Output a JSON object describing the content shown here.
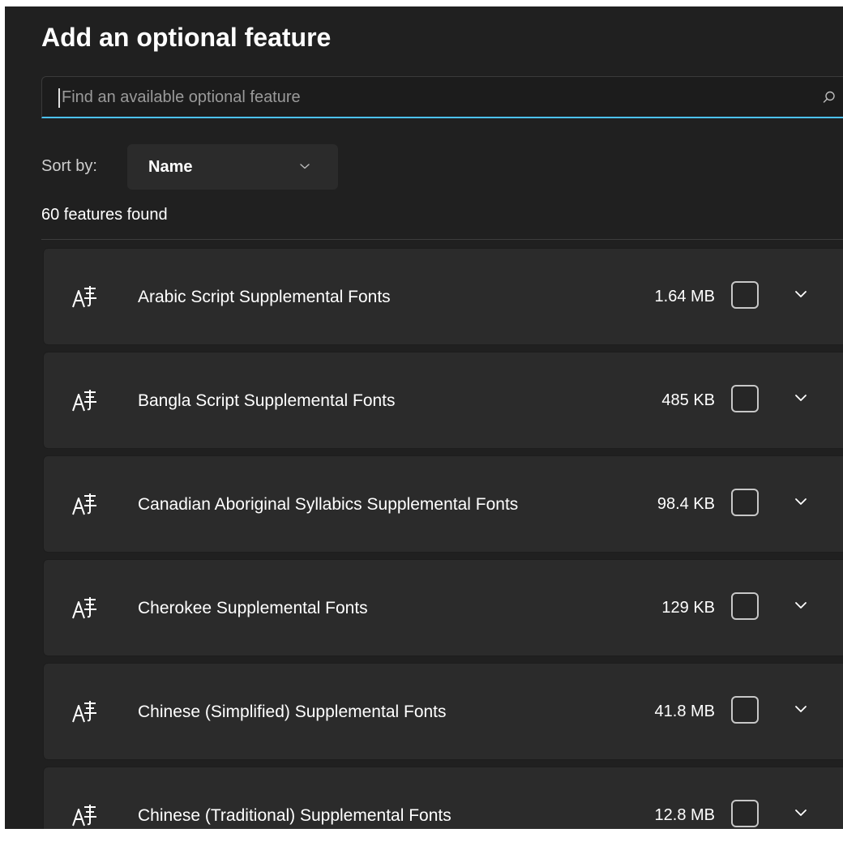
{
  "title": "Add an optional feature",
  "search": {
    "placeholder": "Find an available optional feature",
    "icon": "search-icon"
  },
  "sort": {
    "label": "Sort by:",
    "value": "Name"
  },
  "count_text": "60 features found",
  "colors": {
    "background": "#202020",
    "card": "#2b2b2b",
    "accent": "#4cc2ff",
    "text": "#ffffff",
    "placeholder": "#9a9a9a"
  },
  "features": [
    {
      "name": "Arabic Script Supplemental Fonts",
      "size": "1.64 MB",
      "icon": "font-icon",
      "checked": false
    },
    {
      "name": "Bangla Script Supplemental Fonts",
      "size": "485 KB",
      "icon": "font-icon",
      "checked": false
    },
    {
      "name": "Canadian Aboriginal Syllabics Supplemental Fonts",
      "size": "98.4 KB",
      "icon": "font-icon",
      "checked": false
    },
    {
      "name": "Cherokee Supplemental Fonts",
      "size": "129 KB",
      "icon": "font-icon",
      "checked": false
    },
    {
      "name": "Chinese (Simplified) Supplemental Fonts",
      "size": "41.8 MB",
      "icon": "font-icon",
      "checked": false
    },
    {
      "name": "Chinese (Traditional) Supplemental Fonts",
      "size": "12.8 MB",
      "icon": "font-icon",
      "checked": false
    }
  ]
}
